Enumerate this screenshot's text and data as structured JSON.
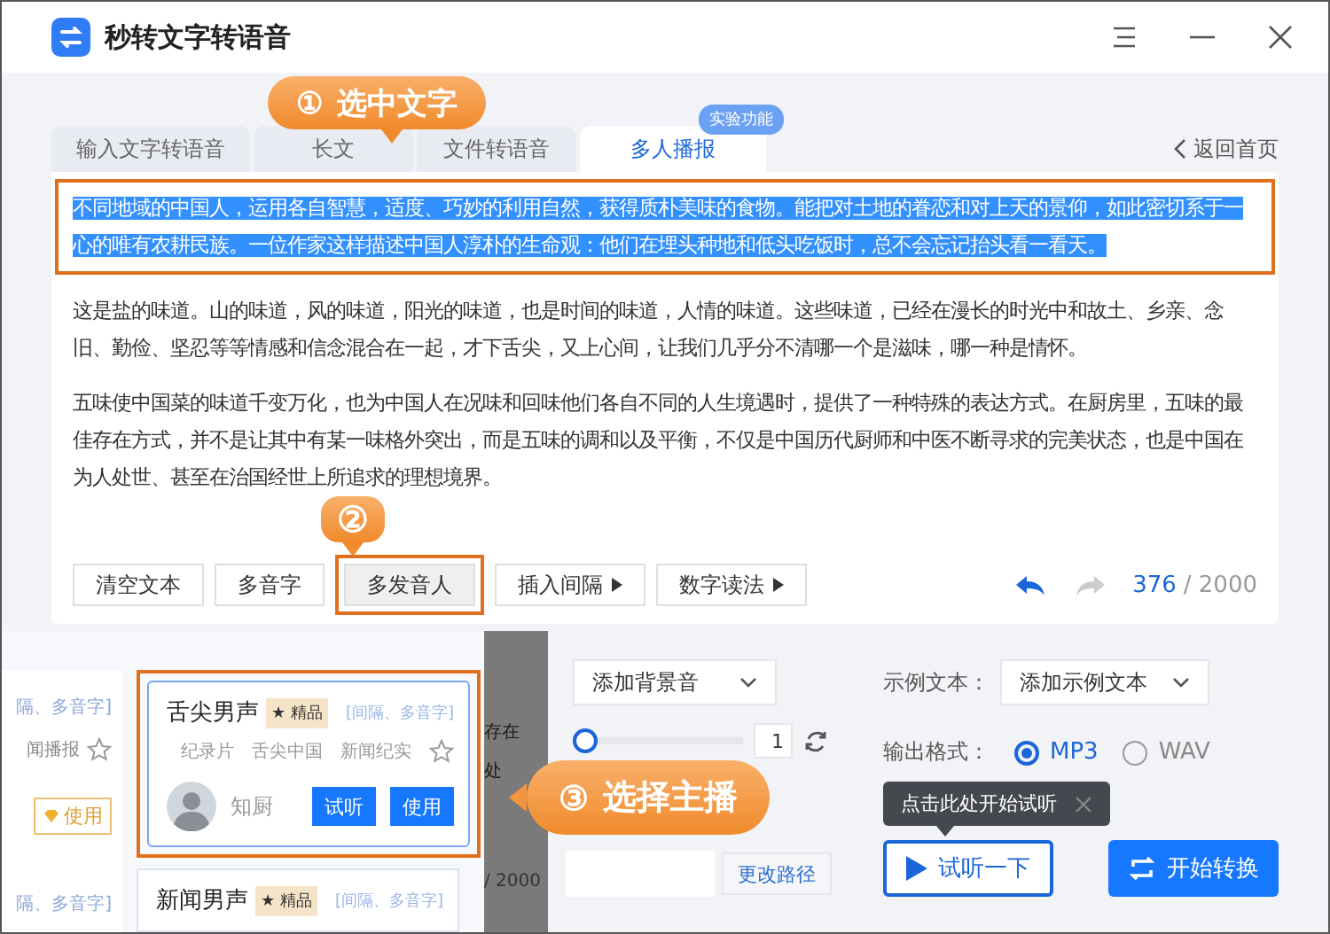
{
  "window": {
    "title": "秒转文字转语音"
  },
  "callouts": [
    {
      "number": "①",
      "text": "选中文字"
    },
    {
      "number": "②"
    },
    {
      "number": "③",
      "text": "选择主播"
    }
  ],
  "tabs": [
    {
      "label": "输入文字转语音",
      "selected": false
    },
    {
      "label": "长文",
      "selected": false
    },
    {
      "label": "文件转语音",
      "selected": false
    },
    {
      "label": "多人播报",
      "selected": true,
      "badge": "实验功能"
    }
  ],
  "back_link": "返回首页",
  "editor": {
    "paragraphs": [
      {
        "text": "不同地域的中国人，运用各自智慧，适度、巧妙的利用自然，获得质朴美味的食物。能把对土地的眷恋和对上天的景仰，如此密切系于一心的唯有农耕民族。一位作家这样描述中国人淳朴的生命观：他们在埋头种地和低头吃饭时，总不会忘记抬头看一看天。",
        "selected": true
      },
      {
        "text": "这是盐的味道。山的味道，风的味道，阳光的味道，也是时间的味道，人情的味道。这些味道，已经在漫长的时光中和故土、乡亲、念旧、勤俭、坚忍等等情感和信念混合在一起，才下舌尖，又上心间，让我们几乎分不清哪一个是滋味，哪一种是情怀。",
        "selected": false
      },
      {
        "text": "五味使中国菜的味道千变万化，也为中国人在况味和回味他们各自不同的人生境遇时，提供了一种特殊的表达方式。在厨房里，五味的最佳存在方式，并不是让其中有某一味格外突出，而是五味的调和以及平衡，不仅是中国历代厨师和中医不断寻求的完美状态，也是中国在为人处世、甚至在治国经世上所追求的理想境界。",
        "selected": false
      }
    ],
    "toolbar": [
      {
        "label": "清空文本",
        "kind": "plain",
        "selected": false
      },
      {
        "label": "多音字",
        "kind": "plain",
        "selected": false
      },
      {
        "label": "多发音人",
        "kind": "plain",
        "selected": true
      },
      {
        "label": "插入间隔",
        "kind": "menu",
        "selected": false
      },
      {
        "label": "数字读法",
        "kind": "menu",
        "selected": false
      }
    ],
    "undo": {
      "disabled": false
    },
    "redo": {
      "disabled": true
    },
    "count": "376",
    "limit": "/ 2000"
  },
  "voice_picker": {
    "side_column": [
      {
        "kind": "tag",
        "text": "隔、多音字]"
      },
      {
        "kind": "category",
        "text": "闻播报"
      },
      {
        "kind": "button",
        "text": "使用"
      },
      {
        "kind": "tag",
        "text": "隔、多音字]"
      }
    ],
    "cards": [
      {
        "name": "舌尖男声",
        "badge": "★ 精品",
        "note": "[间隔、多音字]",
        "categories": [
          "纪录片",
          "舌尖中国",
          "新闻纪实"
        ],
        "author": "知厨",
        "buttons": [
          "试听",
          "使用"
        ],
        "selected": true
      },
      {
        "name": "新闻男声",
        "badge": "★ 精品",
        "note": "[间隔、多音字]",
        "selected": false
      }
    ]
  },
  "covered_labels": [
    "存在",
    "处",
    "/ 2000"
  ],
  "background_music": {
    "value": "添加背景音"
  },
  "speed": {
    "level": 0.0,
    "value": "1"
  },
  "save_path": {
    "button": "更改路径"
  },
  "sample_text": {
    "label": "示例文本：",
    "value": "添加示例文本"
  },
  "output_format": {
    "label": "输出格式：",
    "options": [
      {
        "label": "MP3",
        "selected": true
      },
      {
        "label": "WAV",
        "selected": false
      }
    ]
  },
  "tooltip": "点击此处开始试听",
  "preview_button": "试听一下",
  "convert_button": "开始转换"
}
